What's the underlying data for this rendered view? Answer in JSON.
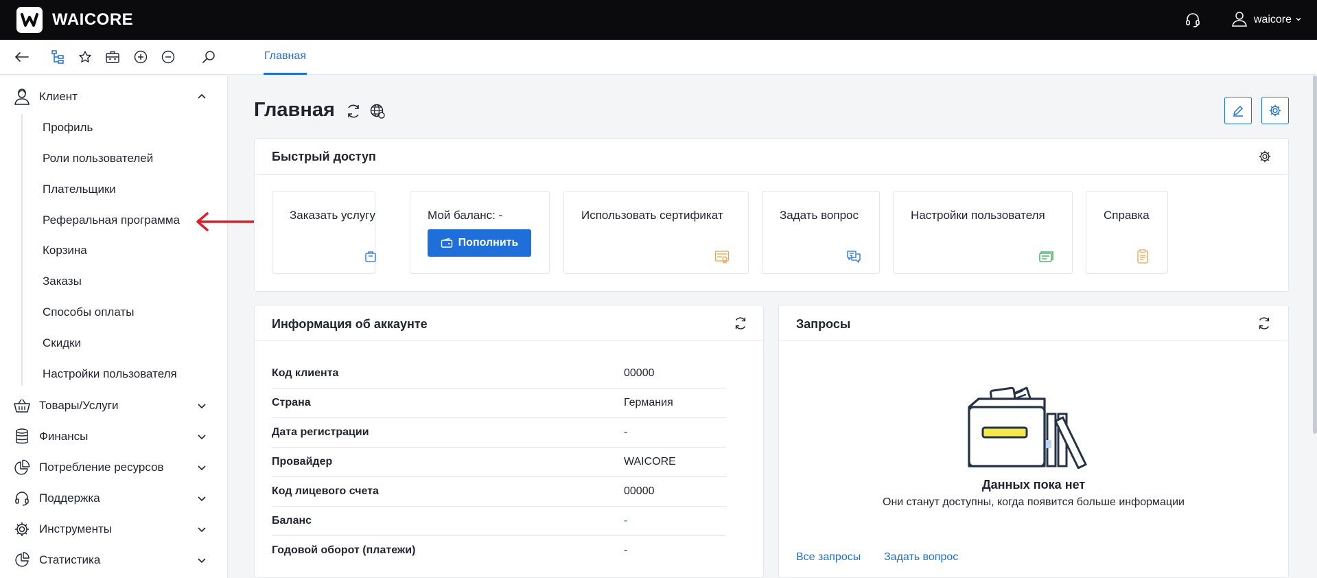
{
  "app": {
    "brand": "WAICORE",
    "logo_letter": "W",
    "username": "waicore"
  },
  "toolbar": {
    "active_tab": "Главная"
  },
  "sidebar": {
    "client_label": "Клиент",
    "client_items": [
      "Профиль",
      "Роли пользователей",
      "Плательщики",
      "Реферальная программа",
      "Корзина",
      "Заказы",
      "Способы оплаты",
      "Скидки",
      "Настройки пользователя"
    ],
    "sections": [
      "Товары/Услуги",
      "Финансы",
      "Потребление ресурсов",
      "Поддержка",
      "Инструменты",
      "Статистика"
    ]
  },
  "page": {
    "title": "Главная"
  },
  "quick_access": {
    "title": "Быстрый доступ",
    "tiles": {
      "order": "Заказать услугу",
      "balance": "Мой баланс: -",
      "topup": "Пополнить",
      "certificate": "Использовать сертификат",
      "question": "Задать вопрос",
      "user_settings": "Настройки пользователя",
      "help": "Справка"
    }
  },
  "account_info": {
    "title": "Информация об аккаунте",
    "rows": [
      {
        "key": "Код клиента",
        "value": "00000"
      },
      {
        "key": "Страна",
        "value": "Германия"
      },
      {
        "key": "Дата регистрации",
        "value": "-"
      },
      {
        "key": "Провайдер",
        "value": "WAICORE"
      },
      {
        "key": "Код лицевого счета",
        "value": "00000"
      },
      {
        "key": "Баланс",
        "value": "-"
      },
      {
        "key": "Годовой оборот (платежи)",
        "value": "-"
      }
    ]
  },
  "requests": {
    "title": "Запросы",
    "empty_title": "Данных пока нет",
    "empty_sub": "Они станут доступны, когда появится больше информации",
    "link_all": "Все запросы",
    "link_ask": "Задать вопрос"
  },
  "colors": {
    "accent": "#1e6fd9",
    "topbar": "#0b0b0d",
    "arrow": "#d9222a",
    "orange": "#f0a045",
    "green": "#2fa84f"
  }
}
